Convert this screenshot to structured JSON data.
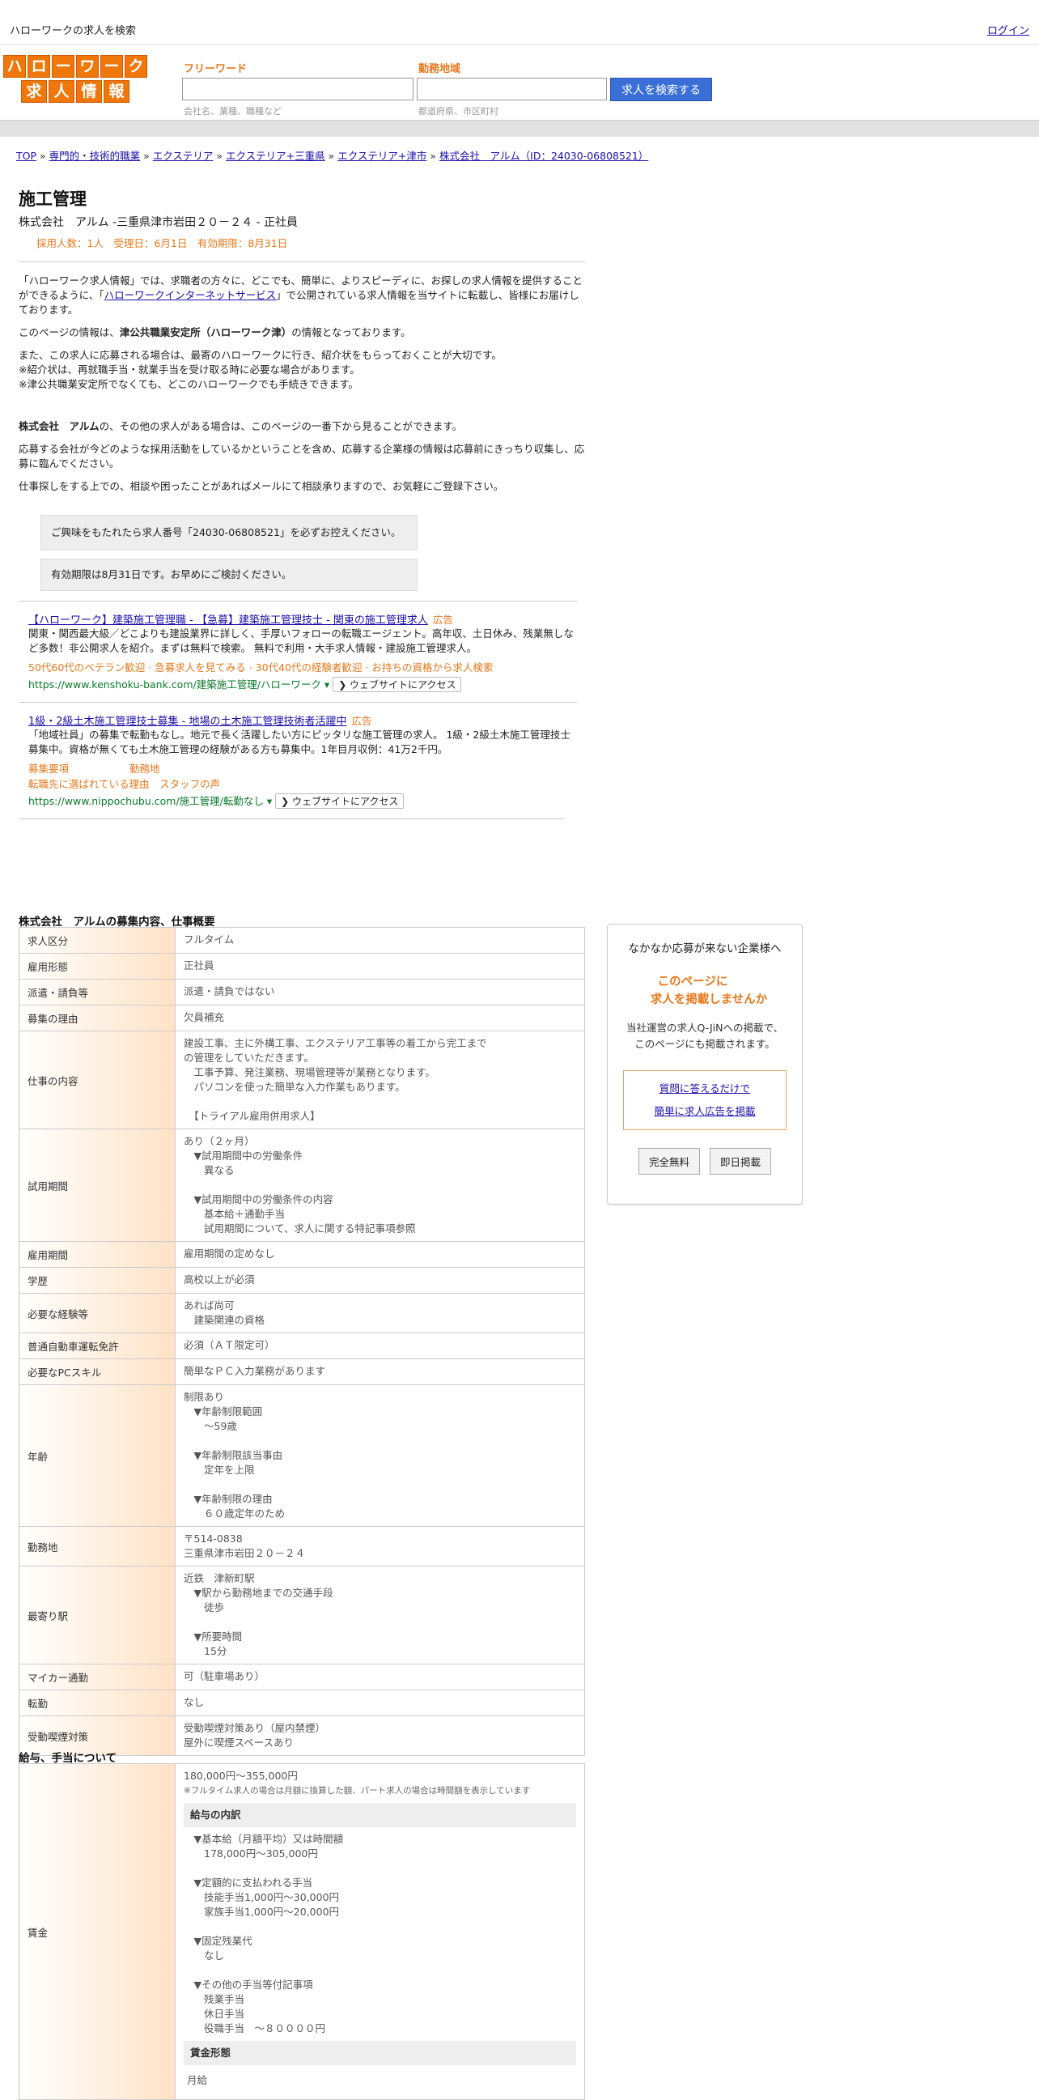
{
  "topbar": {
    "title": "ハローワークの求人を検索",
    "login": "ログイン"
  },
  "logo": {
    "row1": [
      "ハ",
      "ロ",
      "ー",
      "ワ",
      "ー",
      "ク"
    ],
    "row2": [
      "求",
      "人",
      "情",
      "報"
    ]
  },
  "search": {
    "freeword_label": "フリーワード",
    "freeword_placeholder": "会社名、業種、職種など",
    "area_label": "勤務地域",
    "area_placeholder": "都道府県、市区町村",
    "button": "求人を検索する"
  },
  "breadcrumb": [
    "TOP",
    "専門的・技術的職業",
    "エクステリア",
    "エクステリア+三重県",
    "エクステリア+津市",
    "株式会社　アルム（ID：24030-06808521）"
  ],
  "breadcrumb_sep": "»",
  "job": {
    "title": "施工管理",
    "company_line": "株式会社　アルム -三重県津市岩田２０－２４ - 正社員",
    "meta": "採用人数：1人　受理日：6月1日　有効期限：8月31日"
  },
  "intro": {
    "p1_a": "「ハローワーク求人情報」では、求職者の方々に、どこでも、簡単に、よりスピーディに、お探しの求人情報を提供することができるように、「",
    "p1_link": "ハローワークインターネットサービス",
    "p1_b": "」で公開されている求人情報を当サイトに転載し、皆様にお届けしております。",
    "p2_a": "このページの情報は、",
    "p2_bold": "津公共職業安定所（ハローワーク津）",
    "p2_b": "の情報となっております。",
    "p3": "また、この求人に応募される場合は、最寄のハローワークに行き、紹介状をもらっておくことが大切です。",
    "p4": "※紹介状は、再就職手当・就業手当を受け取る時に必要な場合があります。",
    "p5": "※津公共職業安定所でなくても、どこのハローワークでも手続きできます。",
    "p6_bold": "株式会社　アルム",
    "p6_b": "の、その他の求人がある場合は、このページの一番下から見ることができます。",
    "p7": "応募する会社が今どのような採用活動をしているかということを含め、応募する企業様の情報は応募前にきっちり収集し、応募に臨んでください。",
    "p8": "仕事探しをする上での、相談や困ったことがあればメールにて相談承りますので、お気軽にご登録下さい。"
  },
  "notices": [
    "ご興味をもたれたら求人番号「24030-06808521」を必ずお控えください。",
    "有効期限は8月31日です。お早めにご検討ください。"
  ],
  "ads": [
    {
      "title": "【ハローワーク】建築施工管理職 - 【急募】建築施工管理技士 - 関東の施工管理求人",
      "label": "広告",
      "desc": "関東・関西最大級／どこよりも建設業界に詳しく、手厚いフォローの転職エージェント。高年収、土日休み、残業無しなど多数！非公開求人を紹介。まずは無料で検索。 無料で利用・大手求人情報・建設施工管理求人。",
      "orange": "50代60代のベテラン歓迎 · 急募求人を見てみる · 30代40代の経験者歓迎 · お持ちの資格から求人検索",
      "url": "https://www.kenshoku-bank.com/建築施工管理/ハローワーク ▾",
      "btn": "❯ ウェブサイトにアクセス"
    },
    {
      "title": "1級・2級土木施工管理技士募集 - 地場の土木施工管理技術者活躍中",
      "label": "広告",
      "desc": "「地域社員」の募集で転勤もなし。地元で長く活躍したい方にピッタリな施工管理の求人。 1級・2級土木施工管理技士募集中。資格が無くても土木施工管理の経験がある方も募集中。1年目月収例：41万2千円。",
      "orange": "募集要項　　　　　　勤務地\n転職先に選ばれている理由　スタッフの声",
      "url": "https://www.nippochubu.com/施工管理/転勤なし ▾",
      "btn": "❯ ウェブサイトにアクセス"
    }
  ],
  "details": {
    "section_title": "株式会社　アルムの募集内容、仕事概要",
    "rows": [
      {
        "k": "求人区分",
        "v": "フルタイム"
      },
      {
        "k": "雇用形態",
        "v": "正社員"
      },
      {
        "k": "派遣・請負等",
        "v": "派遣・請負ではない"
      },
      {
        "k": "募集の理由",
        "v": "欠員補充"
      },
      {
        "k": "仕事の内容",
        "v": "建設工事、主に外構工事、エクステリア工事等の着工から完工まで\nの管理をしていただきます。\n　工事予算、発注業務、現場管理等が業務となります。\n　パソコンを使った簡単な入力作業もあります。\n\n　【トライアル雇用併用求人】"
      },
      {
        "k": "試用期間",
        "v": "あり（２ヶ月）\n　▼試用期間中の労働条件\n　　異なる\n\n　▼試用期間中の労働条件の内容\n　　基本給＋通勤手当\n　　試用期間について、求人に関する特記事項参照"
      },
      {
        "k": "雇用期間",
        "v": "雇用期間の定めなし"
      },
      {
        "k": "学歴",
        "v": "高校以上が必須"
      },
      {
        "k": "必要な経験等",
        "v": "あれば尚可\n　建築関連の資格"
      },
      {
        "k": "普通自動車運転免許",
        "v": "必須（ＡＴ限定可）"
      },
      {
        "k": "必要なPCスキル",
        "v": "簡単なＰＣ入力業務があります"
      },
      {
        "k": "年齢",
        "v": "制限あり\n　▼年齢制限範囲\n　　〜59歳\n\n　▼年齢制限該当事由\n　　定年を上限\n\n　▼年齢制限の理由\n　　６０歳定年のため"
      },
      {
        "k": "勤務地",
        "v": "〒514-0838\n三重県津市岩田２０－２４"
      },
      {
        "k": "最寄り駅",
        "v": "近鉄　津新町駅\n　▼駅から勤務地までの交通手段\n　　徒歩\n\n　▼所要時間\n　　15分"
      },
      {
        "k": "マイカー通勤",
        "v": "可（駐車場あり）"
      },
      {
        "k": "転勤",
        "v": "なし"
      },
      {
        "k": "受動喫煙対策",
        "v": "受動喫煙対策あり（屋内禁煙）\n屋外に喫煙スペースあり"
      }
    ]
  },
  "salary": {
    "section_title": "給与、手当について",
    "key": "賃金",
    "range": "180,000円〜355,000円",
    "note": "※フルタイム求人の場合は月額に換算した額、パート求人の場合は時間額を表示しています",
    "breakdown_head": "給与の内訳",
    "breakdown": "　▼基本給（月額平均）又は時間額\n　　178,000円〜305,000円\n\n　▼定額的に支払われる手当\n　　技能手当1,000円〜30,000円\n　　家族手当1,000円〜20,000円\n\n　▼固定残業代\n　　なし\n\n　▼その他の手当等付記事項\n　　残業手当\n　　休日手当\n　　役職手当　〜８００００円",
    "form_head": "賃金形態",
    "form": "月給"
  },
  "sidebox": {
    "title": "なかなか応募が来ない企業様へ",
    "orange1": "このページに",
    "orange2": "求人を掲載しませんか",
    "text1": "当社運営の求人Q-JiNへの掲載で、",
    "text2": "このページにも掲載されます。",
    "link1": "質問に答えるだけで",
    "link2": "簡単に求人広告を掲載",
    "btn1": "完全無料",
    "btn2": "即日掲載"
  }
}
